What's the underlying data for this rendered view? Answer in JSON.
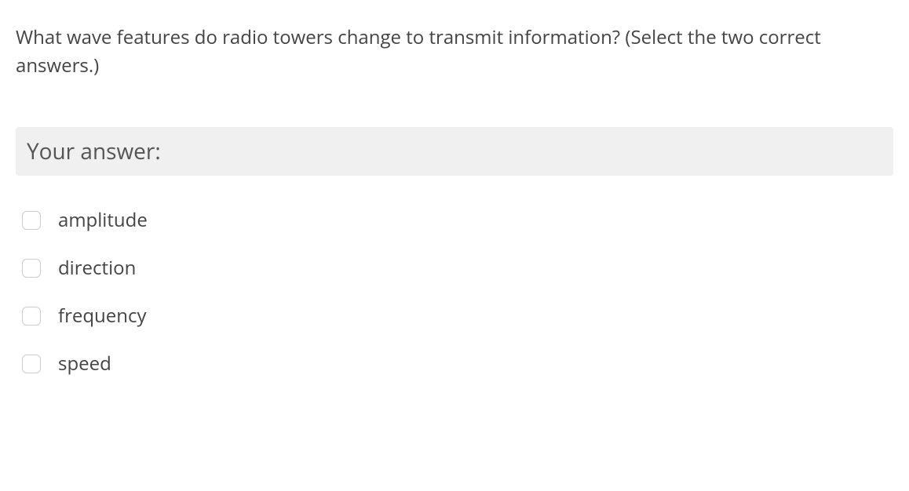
{
  "question": {
    "text": "What wave features do radio towers change to transmit information? (Select the two correct answers.)"
  },
  "answer_header": "Your answer:",
  "options": [
    {
      "label": "amplitude"
    },
    {
      "label": "direction"
    },
    {
      "label": "frequency"
    },
    {
      "label": "speed"
    }
  ]
}
